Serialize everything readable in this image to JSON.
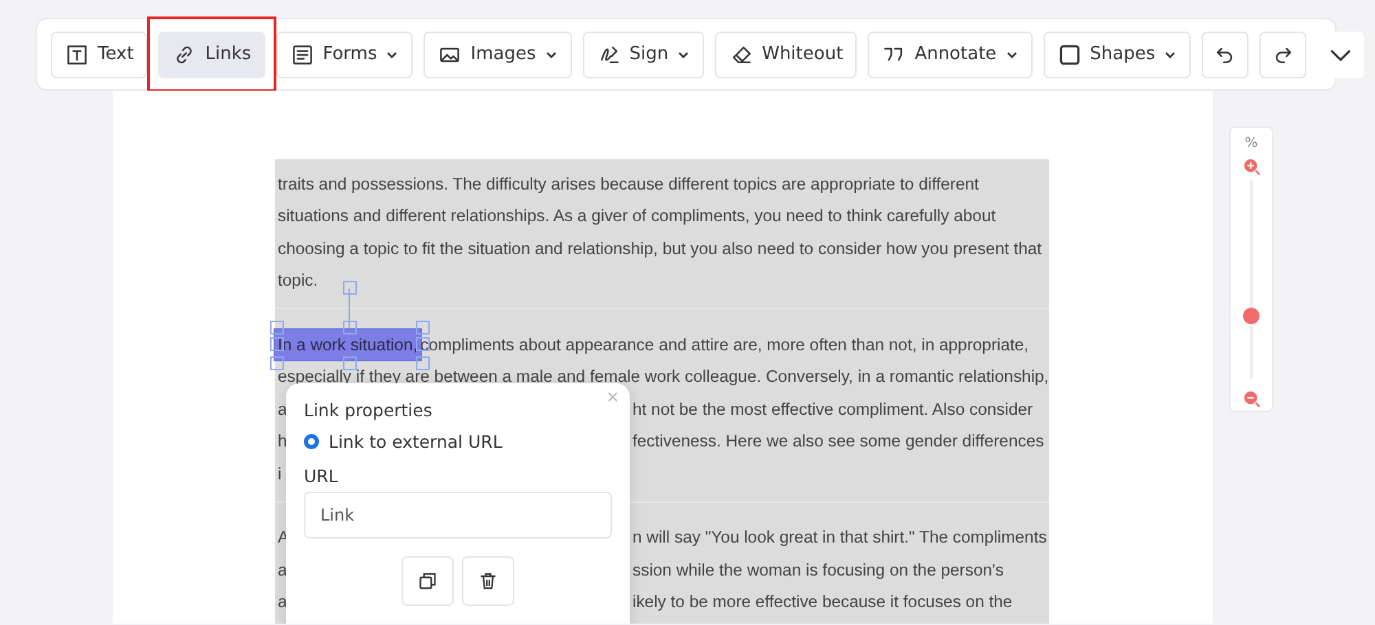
{
  "toolbar": {
    "tools": [
      {
        "kind": "text",
        "label": "Text",
        "selected": false,
        "dropdown": false,
        "outlined": false
      },
      {
        "kind": "link",
        "label": "Links",
        "selected": true,
        "dropdown": false,
        "outlined": true
      },
      {
        "kind": "forms",
        "label": "Forms",
        "selected": false,
        "dropdown": true,
        "outlined": false
      },
      {
        "kind": "images",
        "label": "Images",
        "selected": false,
        "dropdown": true,
        "outlined": false
      },
      {
        "kind": "sign",
        "label": "Sign",
        "selected": false,
        "dropdown": true,
        "outlined": false
      },
      {
        "kind": "whiteout",
        "label": "Whiteout",
        "selected": false,
        "dropdown": false,
        "outlined": false
      },
      {
        "kind": "annotate",
        "label": "Annotate",
        "selected": false,
        "dropdown": true,
        "outlined": false
      },
      {
        "kind": "shapes",
        "label": "Shapes",
        "selected": false,
        "dropdown": true,
        "outlined": false
      },
      {
        "kind": "undo",
        "selected": false,
        "dropdown": false,
        "outlined": false
      },
      {
        "kind": "redo",
        "selected": false,
        "dropdown": false,
        "outlined": false
      },
      {
        "kind": "more",
        "selected": false,
        "dropdown": false,
        "outlined": false
      }
    ]
  },
  "document": {
    "paragraphs": [
      {
        "lines": [
          {
            "segments": [
              {
                "text": "traits and possessions. The difficulty arises because different topics are appropriate to different",
                "link": false
              }
            ]
          },
          {
            "segments": [
              {
                "text": "situations and different relationships. As a giver of compliments, you need to think carefully about",
                "link": false
              }
            ]
          },
          {
            "segments": [
              {
                "text": "choosing a topic to fit the situation and relationship, but you also need to consider how you present that",
                "link": false
              }
            ]
          },
          {
            "segments": [
              {
                "text": "topic.",
                "link": false
              }
            ]
          }
        ]
      },
      {
        "lines": [
          {
            "segments": [
              {
                "text": "In a work situation,",
                "link": true
              },
              {
                "text": " compliments about appearance and attire are, more often than not, in appropriate,",
                "link": false
              }
            ]
          },
          {
            "segments": [
              {
                "text": "especially if they are between a male and female work colleague. Conversely, in a romantic relationship,",
                "link": false
              }
            ]
          },
          {
            "left": "a",
            "right": "ht not be the most effective compliment. Also consider"
          },
          {
            "left": "h",
            "right": "fectiveness. Here we also see some gender differences"
          },
          {
            "left": "i"
          }
        ]
      },
      {
        "lines": [
          {
            "left": "A",
            "right": "n will say \"You look great in that shirt.\" The compliments"
          },
          {
            "left": "a",
            "right": "ssion while the woman is focusing on the person's"
          },
          {
            "left": "a",
            "right": "ikely to be more effective because it focuses on the"
          }
        ]
      }
    ]
  },
  "link_popup": {
    "title": "Link properties",
    "close": "×",
    "option": {
      "label": "Link to external URL",
      "selected": true
    },
    "url_label": "URL",
    "url_field": {
      "placeholder": "Link"
    },
    "actions": [
      {
        "kind": "copy"
      },
      {
        "kind": "delete"
      }
    ]
  },
  "zoom": {
    "label": "%",
    "level": 0.32
  }
}
